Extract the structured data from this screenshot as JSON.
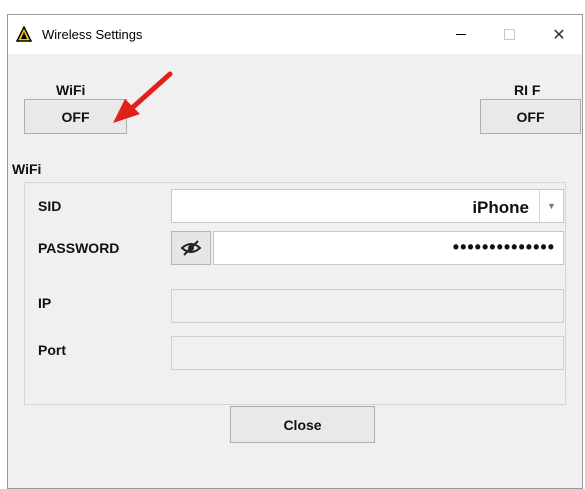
{
  "window": {
    "title": "Wireless Settings"
  },
  "controls": {
    "wifi_label": "WiFi",
    "wifi_button": "OFF",
    "rf_label": "RI F",
    "rf_button": "OFF"
  },
  "group": {
    "title": "WiFi"
  },
  "fields": {
    "sid_label": "SID",
    "sid_value": "iPhone",
    "password_label": "PASSWORD",
    "password_value": "••••••••••••••",
    "ip_label": "IP",
    "ip_value": "",
    "port_label": "Port",
    "port_value": ""
  },
  "footer": {
    "close_label": "Close"
  },
  "icons": {
    "app": "warning-triangle-icon",
    "visibility": "eye-slash-icon",
    "dropdown": "chevron-down-icon",
    "annotation": "red-arrow-icon"
  },
  "colors": {
    "annotation_arrow": "#e0201b"
  }
}
